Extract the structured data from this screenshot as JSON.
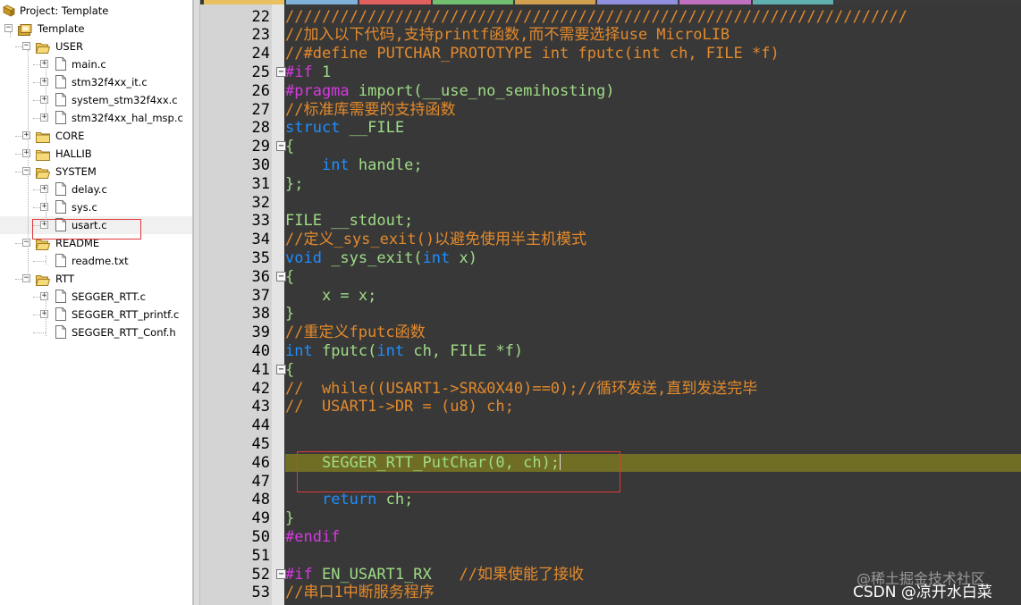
{
  "project": {
    "title": "Project: Template",
    "items": [
      {
        "label": "Template",
        "type": "root",
        "level": 0,
        "expanded": true
      },
      {
        "label": "USER",
        "type": "folder",
        "level": 1,
        "expanded": true
      },
      {
        "label": "main.c",
        "type": "file",
        "level": 2,
        "has_children": true
      },
      {
        "label": "stm32f4xx_it.c",
        "type": "file",
        "level": 2,
        "has_children": true
      },
      {
        "label": "system_stm32f4xx.c",
        "type": "file",
        "level": 2,
        "has_children": true
      },
      {
        "label": "stm32f4xx_hal_msp.c",
        "type": "file",
        "level": 2,
        "has_children": true
      },
      {
        "label": "CORE",
        "type": "folder",
        "level": 1,
        "expanded": false
      },
      {
        "label": "HALLIB",
        "type": "folder",
        "level": 1,
        "expanded": false
      },
      {
        "label": "SYSTEM",
        "type": "folder",
        "level": 1,
        "expanded": true
      },
      {
        "label": "delay.c",
        "type": "file",
        "level": 2,
        "has_children": true
      },
      {
        "label": "sys.c",
        "type": "file",
        "level": 2,
        "has_children": true
      },
      {
        "label": "usart.c",
        "type": "file",
        "level": 2,
        "has_children": true,
        "selected": true
      },
      {
        "label": "README",
        "type": "folder",
        "level": 1,
        "expanded": true
      },
      {
        "label": "readme.txt",
        "type": "file",
        "level": 2,
        "has_children": false
      },
      {
        "label": "RTT",
        "type": "folder",
        "level": 1,
        "expanded": true
      },
      {
        "label": "SEGGER_RTT.c",
        "type": "file",
        "level": 2,
        "has_children": true
      },
      {
        "label": "SEGGER_RTT_printf.c",
        "type": "file",
        "level": 2,
        "has_children": true
      },
      {
        "label": "SEGGER_RTT_Conf.h",
        "type": "file",
        "level": 2,
        "has_children": false
      }
    ]
  },
  "editor": {
    "current_line": "46",
    "lines": [
      {
        "n": "22",
        "fold": "",
        "tokens": [
          [
            "c",
            "////////////////////////////////////////////////////////////////////"
          ]
        ]
      },
      {
        "n": "23",
        "fold": "",
        "tokens": [
          [
            "c",
            "//加入以下代码,支持printf函数,而不需要选择use MicroLIB"
          ]
        ]
      },
      {
        "n": "24",
        "fold": "",
        "tokens": [
          [
            "c",
            "//#define PUTCHAR_PROTOTYPE int fputc(int ch, FILE *f)"
          ]
        ]
      },
      {
        "n": "25",
        "fold": "−",
        "tokens": [
          [
            "p",
            "#if"
          ],
          [
            "t",
            " 1"
          ]
        ]
      },
      {
        "n": "26",
        "fold": "",
        "tokens": [
          [
            "p",
            "#pragma"
          ],
          [
            "t",
            " import(__use_no_semihosting)"
          ]
        ]
      },
      {
        "n": "27",
        "fold": "",
        "tokens": [
          [
            "c",
            "//标准库需要的支持函数"
          ]
        ]
      },
      {
        "n": "28",
        "fold": "",
        "tokens": [
          [
            "k",
            "struct"
          ],
          [
            "t",
            " __FILE"
          ]
        ]
      },
      {
        "n": "29",
        "fold": "−",
        "tokens": [
          [
            "t",
            "{"
          ]
        ]
      },
      {
        "n": "30",
        "fold": "",
        "tokens": [
          [
            "t",
            "    "
          ],
          [
            "k",
            "int"
          ],
          [
            "t",
            " handle;"
          ]
        ]
      },
      {
        "n": "31",
        "fold": "",
        "tokens": [
          [
            "t",
            "};"
          ]
        ]
      },
      {
        "n": "32",
        "fold": "",
        "tokens": []
      },
      {
        "n": "33",
        "fold": "",
        "tokens": [
          [
            "t",
            "FILE __stdout;"
          ]
        ]
      },
      {
        "n": "34",
        "fold": "",
        "tokens": [
          [
            "c",
            "//定义_sys_exit()以避免使用半主机模式"
          ]
        ]
      },
      {
        "n": "35",
        "fold": "",
        "tokens": [
          [
            "k",
            "void"
          ],
          [
            "t",
            " _sys_exit("
          ],
          [
            "k",
            "int"
          ],
          [
            "t",
            " x)"
          ]
        ]
      },
      {
        "n": "36",
        "fold": "−",
        "tokens": [
          [
            "t",
            "{"
          ]
        ]
      },
      {
        "n": "37",
        "fold": "",
        "tokens": [
          [
            "t",
            "    x = x;"
          ]
        ]
      },
      {
        "n": "38",
        "fold": "",
        "tokens": [
          [
            "t",
            "}"
          ]
        ]
      },
      {
        "n": "39",
        "fold": "",
        "tokens": [
          [
            "c",
            "//重定义fputc函数"
          ]
        ]
      },
      {
        "n": "40",
        "fold": "",
        "tokens": [
          [
            "k",
            "int"
          ],
          [
            "t",
            " fputc("
          ],
          [
            "k",
            "int"
          ],
          [
            "t",
            " ch, FILE *f)"
          ]
        ]
      },
      {
        "n": "41",
        "fold": "−",
        "tokens": [
          [
            "t",
            "{"
          ]
        ]
      },
      {
        "n": "42",
        "fold": "",
        "tokens": [
          [
            "c",
            "//  while((USART1->SR&0X40)==0);//循环发送,直到发送完毕"
          ]
        ]
      },
      {
        "n": "43",
        "fold": "",
        "tokens": [
          [
            "c",
            "//  USART1->DR = (u8) ch;"
          ]
        ]
      },
      {
        "n": "44",
        "fold": "",
        "tokens": []
      },
      {
        "n": "45",
        "fold": "",
        "tokens": []
      },
      {
        "n": "46",
        "fold": "",
        "tokens": [
          [
            "t",
            "    SEGGER_RTT_PutChar(0, ch);"
          ]
        ]
      },
      {
        "n": "47",
        "fold": "",
        "tokens": []
      },
      {
        "n": "48",
        "fold": "",
        "tokens": [
          [
            "t",
            "    "
          ],
          [
            "k",
            "return"
          ],
          [
            "t",
            " ch;"
          ]
        ]
      },
      {
        "n": "49",
        "fold": "",
        "tokens": [
          [
            "t",
            "}"
          ]
        ]
      },
      {
        "n": "50",
        "fold": "",
        "tokens": [
          [
            "p",
            "#endif"
          ]
        ]
      },
      {
        "n": "51",
        "fold": "",
        "tokens": []
      },
      {
        "n": "52",
        "fold": "−",
        "tokens": [
          [
            "p",
            "#if"
          ],
          [
            "t",
            " EN_USART1_RX   "
          ],
          [
            "c",
            "//如果使能了接收"
          ]
        ]
      },
      {
        "n": "53",
        "fold": "",
        "tokens": [
          [
            "c",
            "//串口1中断服务程序"
          ]
        ]
      }
    ]
  },
  "watermark": {
    "line1": "@稀土掘金技术社区",
    "line2": "CSDN @凉开水白菜"
  },
  "colors": {
    "editor_bg": "#383838",
    "current_line_bg": "#6f6e24",
    "comment": "#e38a2c",
    "keyword": "#1f8fff",
    "preprocessor": "#d63ae0",
    "text": "#9fdc86",
    "annotation_box": "#e0393a"
  }
}
